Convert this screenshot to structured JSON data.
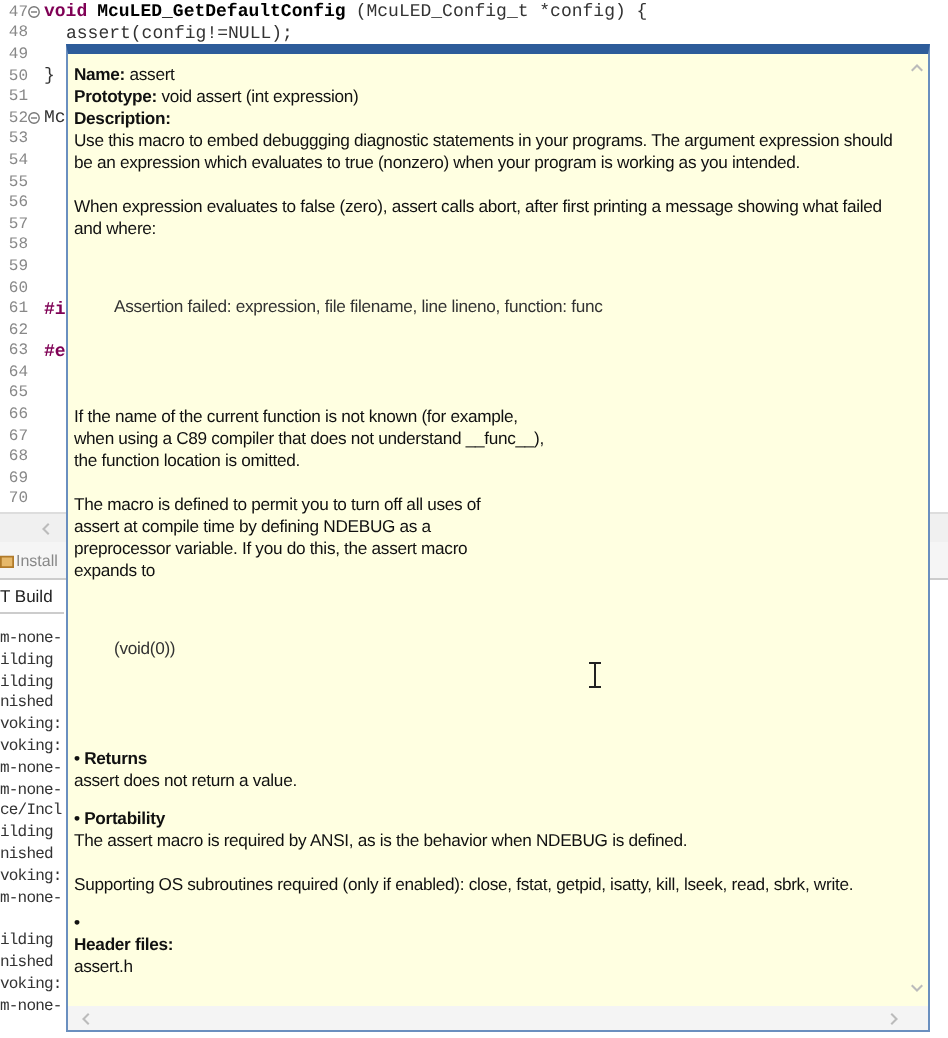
{
  "editor": {
    "lines": [
      {
        "number": "47",
        "fold": true,
        "indented": false,
        "tokens": [
          {
            "kind": "keyword",
            "text": "void"
          },
          {
            "kind": "function",
            "text": "McuLED_GetDefaultConfig"
          },
          {
            "kind": "plain",
            "text": "(McuLED_Config_t *config) {"
          }
        ]
      },
      {
        "number": "48",
        "fold": false,
        "indented": true,
        "tokens": [
          {
            "kind": "plain",
            "text": "assert(config!=NULL);"
          }
        ]
      },
      {
        "number": "49",
        "fold": false
      },
      {
        "number": "50",
        "fold": false,
        "indented": false,
        "tokens": [
          {
            "kind": "plain",
            "text": "}"
          }
        ]
      },
      {
        "number": "51",
        "fold": false
      },
      {
        "number": "52",
        "fold": true,
        "indented": false,
        "tokens": [
          {
            "kind": "plain",
            "text": "Mc"
          }
        ]
      },
      {
        "number": "53",
        "fold": false
      },
      {
        "number": "54",
        "fold": false
      },
      {
        "number": "55",
        "fold": false
      },
      {
        "number": "56",
        "fold": false
      },
      {
        "number": "57",
        "fold": false
      },
      {
        "number": "58",
        "fold": false
      },
      {
        "number": "59",
        "fold": false
      },
      {
        "number": "60",
        "fold": false
      },
      {
        "number": "61",
        "fold": false,
        "indented": false,
        "tokens": [
          {
            "kind": "keyword",
            "text": "#i"
          }
        ]
      },
      {
        "number": "62",
        "fold": false
      },
      {
        "number": "63",
        "fold": false,
        "indented": false,
        "tokens": [
          {
            "kind": "keyword",
            "text": "#e"
          }
        ]
      },
      {
        "number": "64",
        "fold": false
      },
      {
        "number": "65",
        "fold": false
      },
      {
        "number": "66",
        "fold": false
      },
      {
        "number": "67",
        "fold": false
      },
      {
        "number": "68",
        "fold": false
      },
      {
        "number": "69",
        "fold": false
      },
      {
        "number": "70",
        "fold": false
      }
    ]
  },
  "panel": {
    "tabs": [
      {
        "label": "Install",
        "selected": false
      }
    ],
    "header": "T Build",
    "console_groups": [
      [
        "m-none-",
        "ilding",
        "ilding",
        "nished",
        "voking:",
        "voking:",
        "m-none-",
        "m-none-",
        "ce/Incl",
        "ilding",
        "nished",
        "voking:",
        "m-none-"
      ],
      [
        "ilding",
        "nished",
        "voking:",
        "m-none-"
      ]
    ]
  },
  "hover": {
    "blocks": [
      {
        "kind": "field",
        "label": "Name:",
        "text": "assert"
      },
      {
        "kind": "field",
        "label": "Prototype:",
        "text": "void assert (int expression)"
      },
      {
        "kind": "heading",
        "text": "Description:"
      },
      {
        "kind": "paragraph",
        "text": "Use this macro to embed debuggging diagnostic statements in your programs. The argument expression should be an expression which evaluates to true (nonzero) when your program is working as you intended."
      },
      {
        "kind": "paragraph",
        "text": "When expression evaluates to false (zero), assert calls abort, after first printing a message showing what failed and where:"
      },
      {
        "kind": "example",
        "text": "Assertion failed: expression, file filename, line lineno, function: func"
      },
      {
        "kind": "paragraph",
        "text": "If the name of the current function is not known (for example,\nwhen using a C89 compiler that does not understand __func__),\nthe function location is omitted."
      },
      {
        "kind": "paragraph",
        "text": "The macro is defined to permit you to turn off all uses of\nassert at compile time by defining NDEBUG as a\npreprocessor variable. If you do this, the assert macro\nexpands to"
      },
      {
        "kind": "example",
        "text": "(void(0))"
      },
      {
        "kind": "bullet",
        "text": "• Returns"
      },
      {
        "kind": "paragraph",
        "text": "assert does not return a value."
      },
      {
        "kind": "bullet",
        "text": "• Portability"
      },
      {
        "kind": "paragraph",
        "text": "The assert macro is required by ANSI, as is the behavior when NDEBUG is defined."
      },
      {
        "kind": "paragraph",
        "text": "Supporting OS subroutines required (only if enabled): close, fstat, getpid, isatty, kill, lseek, read, sbrk, write."
      },
      {
        "kind": "bullet",
        "text": "•"
      },
      {
        "kind": "heading",
        "text": "Header files:"
      },
      {
        "kind": "paragraph",
        "text": "assert.h"
      }
    ]
  }
}
